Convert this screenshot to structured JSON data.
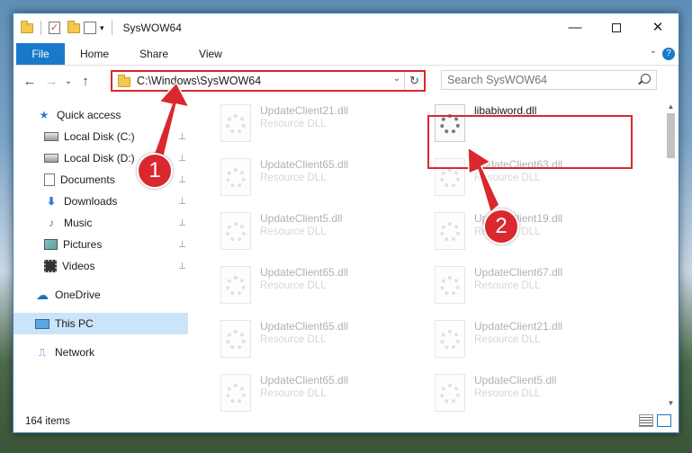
{
  "window": {
    "title": "SysWOW64",
    "minimize_glyph": "—",
    "close_glyph": "✕"
  },
  "ribbon": {
    "tabs": [
      "File",
      "Home",
      "Share",
      "View"
    ],
    "help": "?",
    "collapse_glyph": "⌄"
  },
  "navigation": {
    "back_glyph": "←",
    "forward_glyph": "→",
    "recent_glyph": "⌄",
    "up_glyph": "↑",
    "address_path": "C:\\Windows\\SysWOW64",
    "address_drop_glyph": "⌄",
    "refresh_glyph": "↻",
    "search_placeholder": "Search SysWOW64"
  },
  "sidebar": {
    "items": [
      {
        "label": "Quick access",
        "icon": "star-icon",
        "pinned": false,
        "selected": false
      },
      {
        "label": "Local Disk (C:)",
        "icon": "disk-icon",
        "pinned": true,
        "selected": false
      },
      {
        "label": "Local Disk (D:)",
        "icon": "disk-icon",
        "pinned": true,
        "selected": false
      },
      {
        "label": "Documents",
        "icon": "documents-icon",
        "pinned": true,
        "selected": false
      },
      {
        "label": "Downloads",
        "icon": "downloads-icon",
        "pinned": true,
        "selected": false
      },
      {
        "label": "Music",
        "icon": "music-icon",
        "pinned": true,
        "selected": false
      },
      {
        "label": "Pictures",
        "icon": "pictures-icon",
        "pinned": true,
        "selected": false
      },
      {
        "label": "Videos",
        "icon": "videos-icon",
        "pinned": true,
        "selected": false
      },
      {
        "label": "OneDrive",
        "icon": "onedrive-icon",
        "pinned": false,
        "selected": false
      },
      {
        "label": "This PC",
        "icon": "pc-icon",
        "pinned": false,
        "selected": true
      },
      {
        "label": "Network",
        "icon": "network-icon",
        "pinned": false,
        "selected": false
      }
    ],
    "pin_glyph": "📌"
  },
  "files": [
    {
      "name": "UpdateClient21.dll",
      "type": "Resource DLL",
      "faded": true
    },
    {
      "name": "libabiword.dll",
      "type": "",
      "faded": false
    },
    {
      "name": "UpdateClient65.dll",
      "type": "Resource DLL",
      "faded": true
    },
    {
      "name": "UpdateClient63.dll",
      "type": "Resource DLL",
      "faded": true
    },
    {
      "name": "UpdateClient5.dll",
      "type": "Resource DLL",
      "faded": true
    },
    {
      "name": "UpdateClient19.dll",
      "type": "Resource DLL",
      "faded": true
    },
    {
      "name": "UpdateClient65.dll",
      "type": "Resource DLL",
      "faded": true
    },
    {
      "name": "UpdateClient67.dll",
      "type": "Resource DLL",
      "faded": true
    },
    {
      "name": "UpdateClient65.dll",
      "type": "Resource DLL",
      "faded": true
    },
    {
      "name": "UpdateClient21.dll",
      "type": "Resource DLL",
      "faded": true
    },
    {
      "name": "UpdateClient65.dll",
      "type": "Resource DLL",
      "faded": true
    },
    {
      "name": "UpdateClient5.dll",
      "type": "Resource DLL",
      "faded": true
    }
  ],
  "status": {
    "item_count": "164 items"
  },
  "annotations": {
    "marker_1": "1",
    "marker_2": "2",
    "color": "#d9282e"
  }
}
